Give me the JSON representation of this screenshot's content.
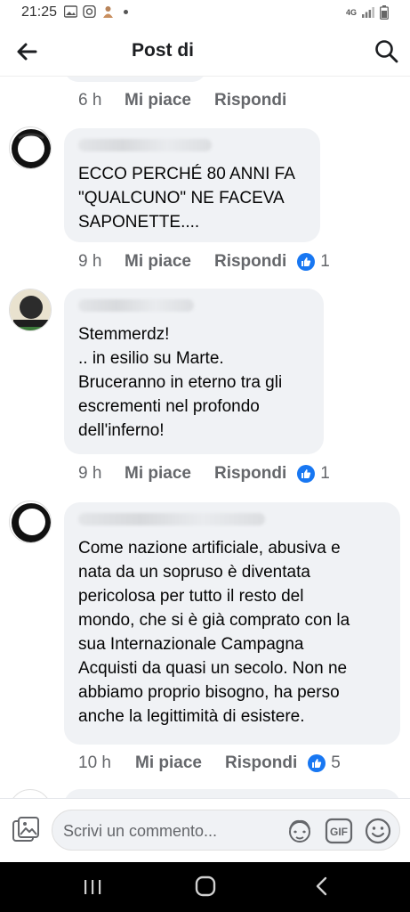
{
  "status_bar": {
    "time": "21:25",
    "network": "4G"
  },
  "header": {
    "title": "Post di"
  },
  "top_actions": {
    "time": "6 h",
    "like_label": "Mi piace",
    "reply_label": "Rispondi"
  },
  "comments": [
    {
      "text": "ECCO PERCHÉ 80 ANNI FA\n\"QUALCUNO\" NE FACEVA\nSAPONETTE....",
      "time": "9 h",
      "like_label": "Mi piace",
      "reply_label": "Rispondi",
      "reactions": "1"
    },
    {
      "text": "Stemmerdz!\n.. in esilio su Marte.\nBruceranno in eterno tra gli\nescrementi nel profondo\ndell'inferno!",
      "time": "9 h",
      "like_label": "Mi piace",
      "reply_label": "Rispondi",
      "reactions": "1"
    },
    {
      "text": "Come nazione artificiale, abusiva e\nnata da un sopruso è diventata\npericolosa per tutto il resto del\nmondo, che si è già comprato con la\nsua Internazionale Campagna\nAcquisti da quasi un secolo. Non ne\nabbiamo proprio bisogno, ha perso\nanche la legittimità di esistere.",
      "time": "10 h",
      "like_label": "Mi piace",
      "reply_label": "Rispondi",
      "reactions": "5"
    }
  ],
  "composer": {
    "placeholder": "Scrivi un commento..."
  },
  "colors": {
    "accent": "#1877f2",
    "bubble": "#f0f2f5",
    "meta_text": "#65676b"
  }
}
